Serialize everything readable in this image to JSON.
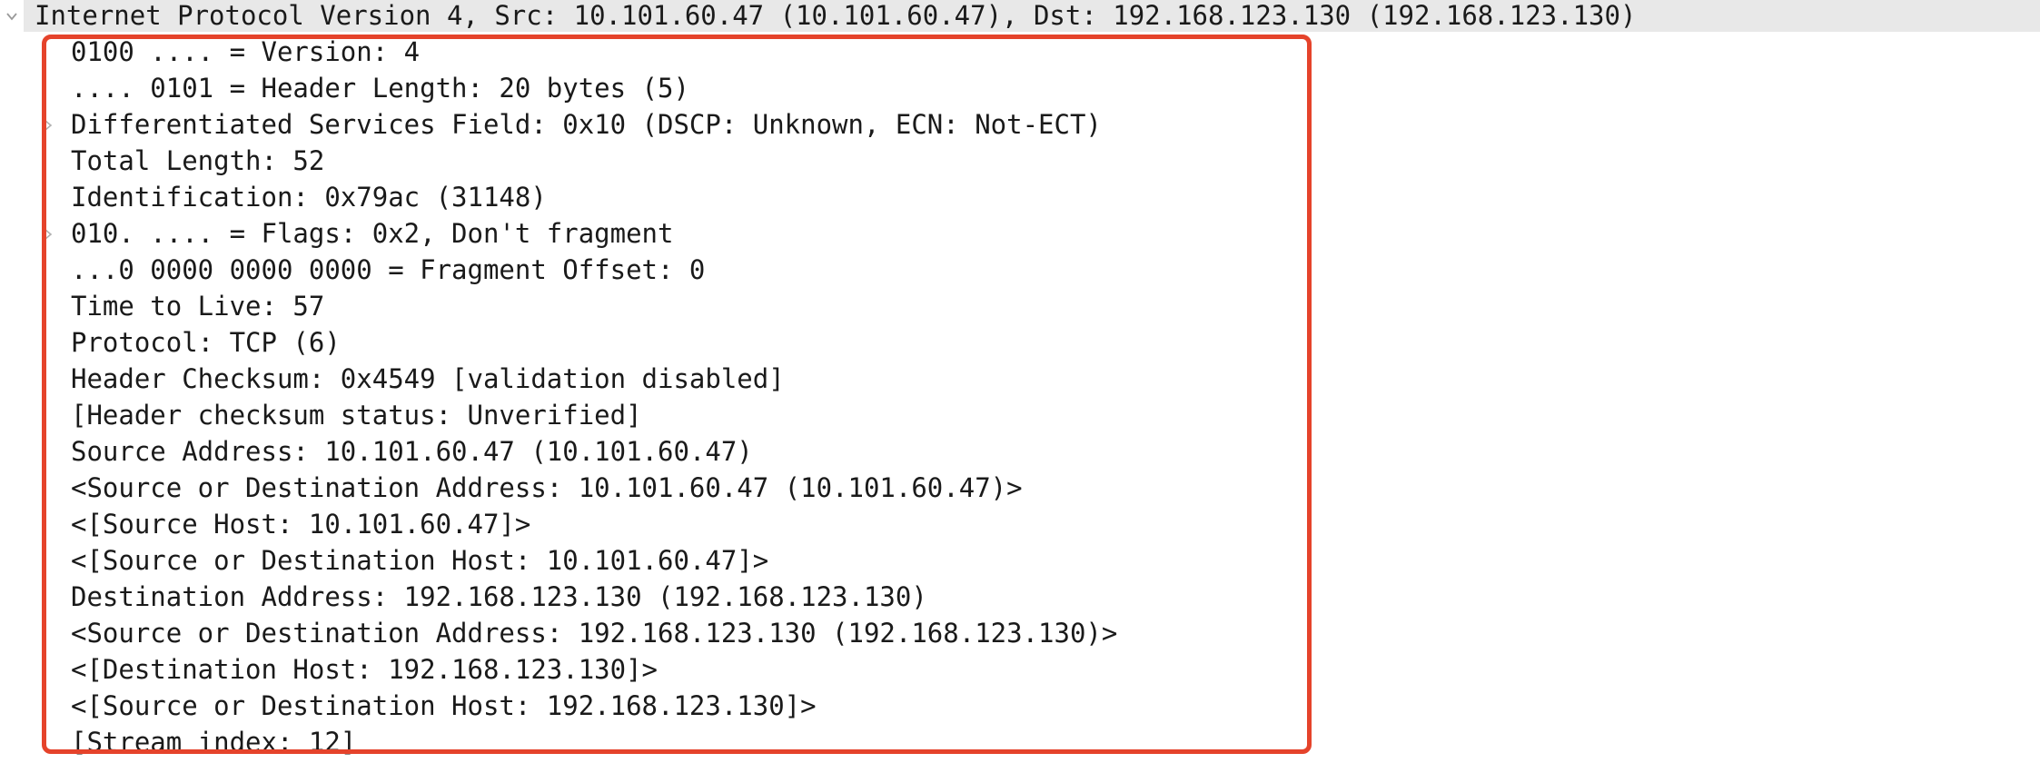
{
  "header": {
    "text": "Internet Protocol Version 4, Src: 10.101.60.47 (10.101.60.47), Dst: 192.168.123.130 (192.168.123.130)",
    "icon": "chevron-down-icon"
  },
  "fields": [
    {
      "text": "0100 .... = Version: 4",
      "expandable": false
    },
    {
      "text": ".... 0101 = Header Length: 20 bytes (5)",
      "expandable": false
    },
    {
      "text": "Differentiated Services Field: 0x10 (DSCP: Unknown, ECN: Not-ECT)",
      "expandable": true
    },
    {
      "text": "Total Length: 52",
      "expandable": false
    },
    {
      "text": "Identification: 0x79ac (31148)",
      "expandable": false
    },
    {
      "text": "010. .... = Flags: 0x2, Don't fragment",
      "expandable": true
    },
    {
      "text": "...0 0000 0000 0000 = Fragment Offset: 0",
      "expandable": false
    },
    {
      "text": "Time to Live: 57",
      "expandable": false
    },
    {
      "text": "Protocol: TCP (6)",
      "expandable": false
    },
    {
      "text": "Header Checksum: 0x4549 [validation disabled]",
      "expandable": false
    },
    {
      "text": "[Header checksum status: Unverified]",
      "expandable": false
    },
    {
      "text": "Source Address: 10.101.60.47 (10.101.60.47)",
      "expandable": false
    },
    {
      "text": "<Source or Destination Address: 10.101.60.47 (10.101.60.47)>",
      "expandable": false
    },
    {
      "text": "<[Source Host: 10.101.60.47]>",
      "expandable": false
    },
    {
      "text": "<[Source or Destination Host: 10.101.60.47]>",
      "expandable": false
    },
    {
      "text": "Destination Address: 192.168.123.130 (192.168.123.130)",
      "expandable": false
    },
    {
      "text": "<Source or Destination Address: 192.168.123.130 (192.168.123.130)>",
      "expandable": false
    },
    {
      "text": "<[Destination Host: 192.168.123.130]>",
      "expandable": false
    },
    {
      "text": "<[Source or Destination Host: 192.168.123.130]>",
      "expandable": false
    },
    {
      "text": "[Stream index: 12]",
      "expandable": false
    }
  ],
  "colors": {
    "highlight": "#e5432b",
    "header_bg": "#e8e8e8",
    "text": "#1a1a1a",
    "expander": "#b0b0b0"
  }
}
